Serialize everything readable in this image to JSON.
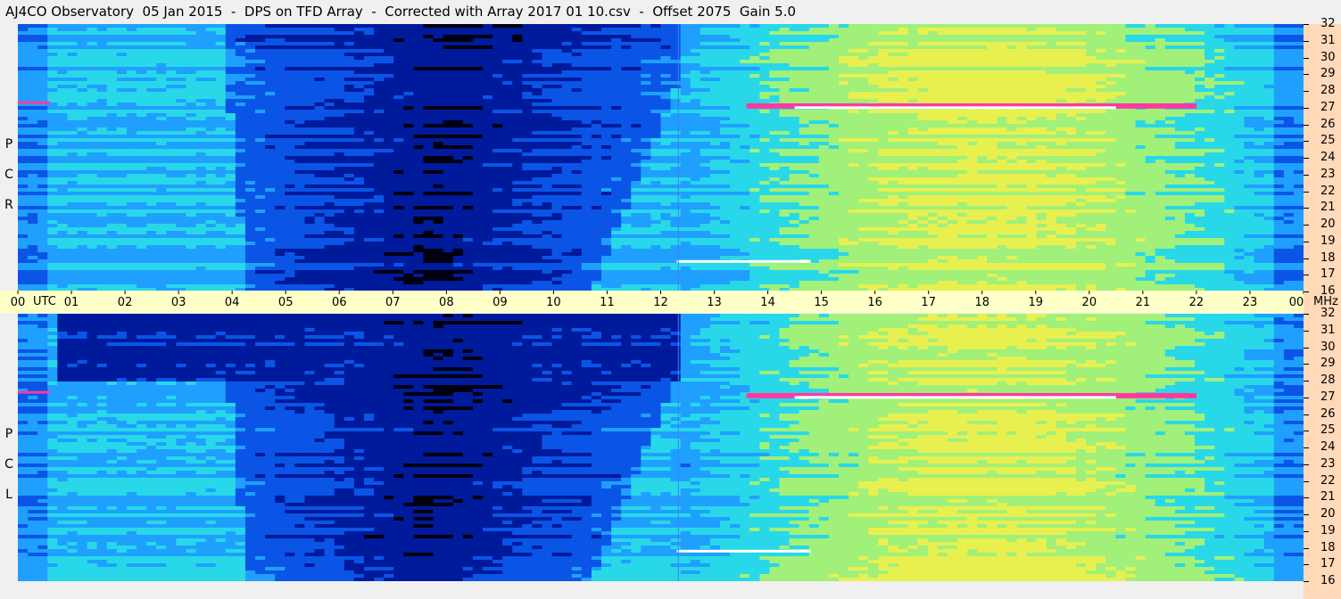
{
  "title": "AJ4CO Observatory  05 Jan 2015  -  DPS on TFD Array  -  Corrected with Array 2017 01 10.csv  -  Offset 2075  Gain 5.0",
  "panels": [
    {
      "id": "rcp",
      "letters": [
        "R",
        "C",
        "P"
      ]
    },
    {
      "id": "lcp",
      "letters": [
        "L",
        "C",
        "P"
      ]
    }
  ],
  "time_axis": {
    "unit": "UTC",
    "hours": [
      "00",
      "01",
      "02",
      "03",
      "04",
      "05",
      "06",
      "07",
      "08",
      "09",
      "10",
      "11",
      "12",
      "13",
      "14",
      "15",
      "16",
      "17",
      "18",
      "19",
      "20",
      "21",
      "22",
      "23",
      "00"
    ]
  },
  "freq_axis": {
    "unit": "MHz",
    "ticks": [
      32,
      31,
      30,
      29,
      28,
      27,
      26,
      25,
      24,
      23,
      22,
      21,
      20,
      19,
      18,
      17,
      16
    ],
    "range": [
      16,
      32
    ]
  },
  "chart_data": {
    "type": "heatmap",
    "title": "AJ4CO Observatory  05 Jan 2015  -  DPS on TFD Array  -  Corrected with Array 2017 01 10.csv  -  Offset 2075  Gain 5.0",
    "x_range": [
      "00 UTC",
      "00 UTC"
    ],
    "y_range": [
      16,
      32
    ],
    "xlabel": "UTC",
    "ylabel": "MHz",
    "series": [
      {
        "name": "RCP"
      },
      {
        "name": "LCP"
      }
    ],
    "colormap": [
      "#000010",
      "#001a9c",
      "#0a55e6",
      "#1fa0ff",
      "#28d8e8",
      "#a0f07a",
      "#e8f050",
      "#ff3aa0",
      "#ffffff"
    ]
  }
}
